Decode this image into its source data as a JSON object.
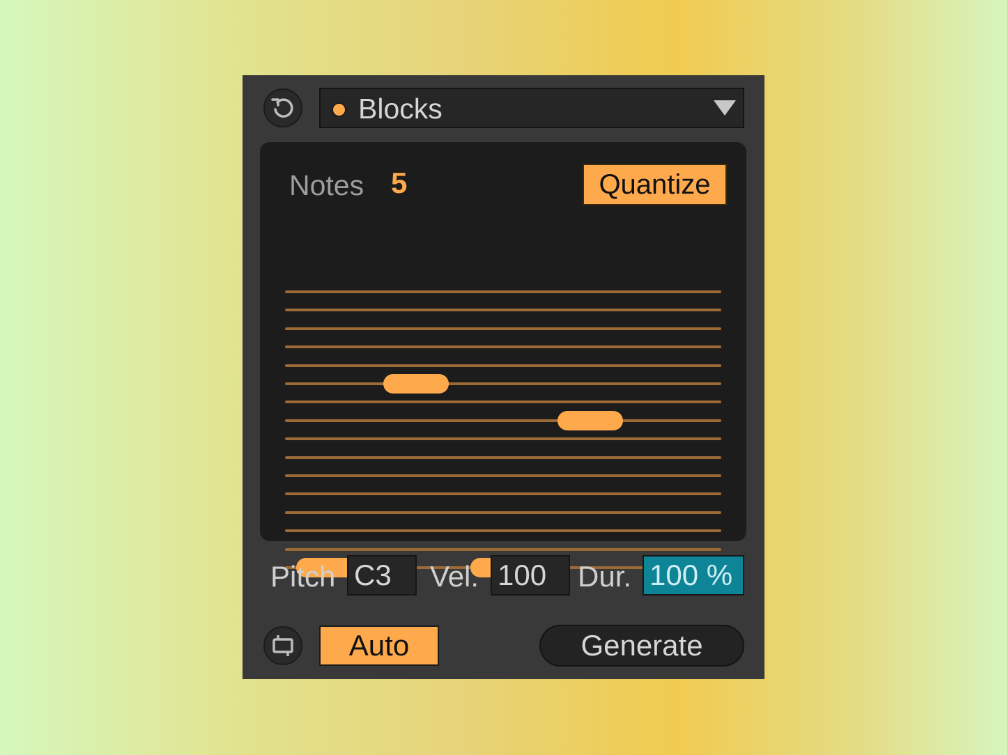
{
  "header": {
    "preset_name": "Blocks",
    "preset_dot_color": "#ffa94d",
    "reset_icon": "reset-icon",
    "dropdown_icon": "dropdown-arrow-icon"
  },
  "panel": {
    "notes_label": "Notes",
    "notes_value": "5",
    "quantize_label": "Quantize",
    "lane_count": 16,
    "blocks": [
      {
        "step": 1,
        "lane": 16
      },
      {
        "step": 2,
        "lane": 6
      },
      {
        "step": 3,
        "lane": 16
      },
      {
        "step": 4,
        "lane": 8
      },
      {
        "step": 5,
        "lane": 16
      }
    ]
  },
  "params": {
    "pitch_label": "Pitch",
    "pitch_value": "C3",
    "vel_label": "Vel.",
    "vel_value": "100",
    "dur_label": "Dur.",
    "dur_value": "100 %"
  },
  "footer": {
    "loop_icon": "loop-icon",
    "auto_label": "Auto",
    "generate_label": "Generate"
  },
  "colors": {
    "accent": "#ffa94d",
    "lane": "#9b6a37",
    "active_field": "#0e8497",
    "device_bg": "#393939",
    "panel_bg": "#1c1c1c"
  }
}
